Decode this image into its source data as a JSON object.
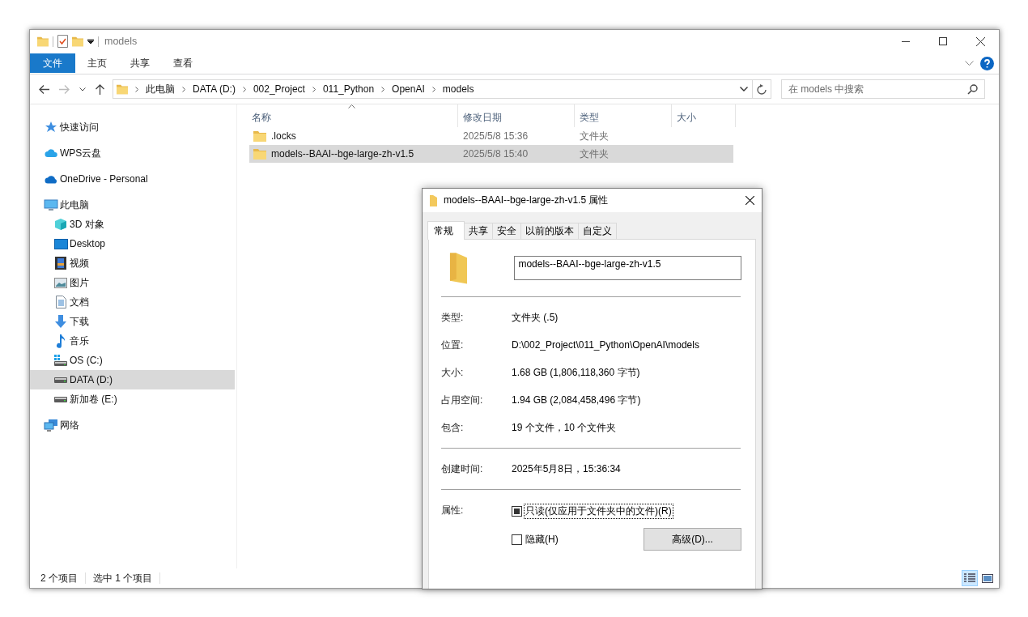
{
  "explorer": {
    "title": "models",
    "ribbon_tabs": [
      {
        "label": "文件",
        "selected": true
      },
      {
        "label": "主页",
        "selected": false
      },
      {
        "label": "共享",
        "selected": false
      },
      {
        "label": "查看",
        "selected": false
      }
    ],
    "address": {
      "crumbs": [
        "此电脑",
        "DATA (D:)",
        "002_Project",
        "011_Python",
        "OpenAI",
        "models"
      ]
    },
    "search": {
      "placeholder": "在 models 中搜索"
    },
    "sidebar": {
      "items": [
        {
          "label": "快速访问",
          "selected": false
        },
        {
          "label": "WPS云盘",
          "selected": false
        },
        {
          "label": "OneDrive - Personal",
          "selected": false
        },
        {
          "label": "此电脑",
          "selected": false,
          "children": [
            {
              "label": "3D 对象",
              "selected": false
            },
            {
              "label": "Desktop",
              "selected": false
            },
            {
              "label": "视频",
              "selected": false
            },
            {
              "label": "图片",
              "selected": false
            },
            {
              "label": "文档",
              "selected": false
            },
            {
              "label": "下载",
              "selected": false
            },
            {
              "label": "音乐",
              "selected": false
            },
            {
              "label": "OS (C:)",
              "selected": false
            },
            {
              "label": "DATA (D:)",
              "selected": true
            },
            {
              "label": "新加卷 (E:)",
              "selected": false
            }
          ]
        },
        {
          "label": "网络",
          "selected": false
        }
      ]
    },
    "file_list": {
      "columns": [
        {
          "label": "名称",
          "sorted": true
        },
        {
          "label": "修改日期",
          "sorted": false
        },
        {
          "label": "类型",
          "sorted": false
        },
        {
          "label": "大小",
          "sorted": false
        }
      ],
      "rows": [
        {
          "name": ".locks",
          "modified": "2025/5/8 15:36",
          "type": "文件夹",
          "selected": false
        },
        {
          "name": "models--BAAI--bge-large-zh-v1.5",
          "modified": "2025/5/8 15:40",
          "type": "文件夹",
          "selected": true
        }
      ]
    },
    "status_bar": {
      "item_count": "2 个项目",
      "selection": "选中 1 个项目",
      "view_buttons": [
        {
          "selected": true
        },
        {
          "selected": false
        }
      ]
    }
  },
  "properties_dialog": {
    "title": "models--BAAI--bge-large-zh-v1.5 属性",
    "tabs": [
      {
        "label": "常规",
        "selected": true
      },
      {
        "label": "共享",
        "selected": false
      },
      {
        "label": "安全",
        "selected": false
      },
      {
        "label": "以前的版本",
        "selected": false
      },
      {
        "label": "自定义",
        "selected": false
      }
    ],
    "name_value": "models--BAAI--bge-large-zh-v1.5",
    "sections": [
      [
        {
          "label": "类型:",
          "value": "文件夹 (.5)"
        },
        {
          "label": "位置:",
          "value": "D:\\002_Project\\011_Python\\OpenAI\\models"
        },
        {
          "label": "大小:",
          "value": "1.68 GB (1,806,118,360 字节)"
        },
        {
          "label": "占用空间:",
          "value": "1.94 GB (2,084,458,496 字节)"
        },
        {
          "label": "包含:",
          "value": "19 个文件，10 个文件夹"
        }
      ],
      [
        {
          "label": "创建时间:",
          "value": "2025年5月8日，15:36:34"
        }
      ]
    ],
    "attributes": {
      "label": "属性:",
      "options": [
        {
          "label": "只读(仅应用于文件夹中的文件)(R)",
          "checked": false,
          "indeterminate": true,
          "focused": true
        },
        {
          "label": "隐藏(H)",
          "checked": false,
          "indeterminate": false,
          "focused": false
        }
      ],
      "advanced_button": "高级(D)..."
    }
  }
}
